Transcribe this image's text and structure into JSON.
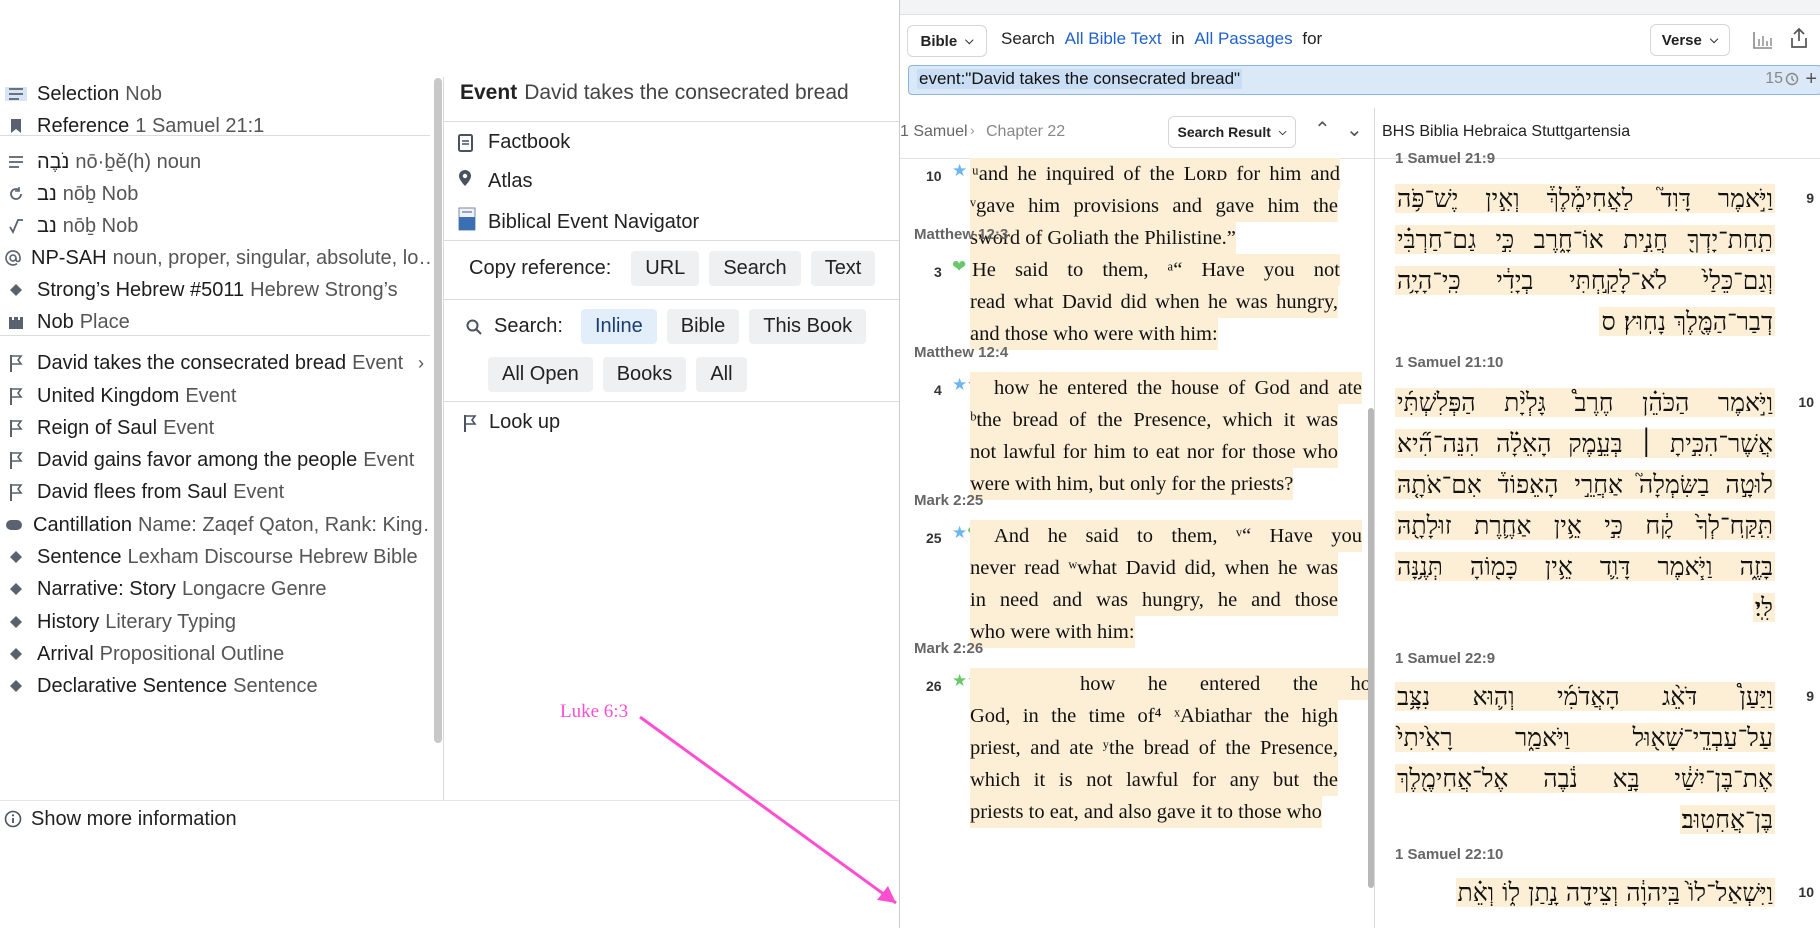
{
  "left_panel": {
    "rows": [
      {
        "icon": "lines-icon",
        "main": "Selection",
        "sub": "Nob"
      },
      {
        "icon": "bookmark-icon",
        "main": "Reference",
        "sub": "1 Samuel 21:1"
      },
      {
        "icon": "lines-icon",
        "main": "נֹבֶה",
        "sub": "nō·ḇě(h) noun"
      },
      {
        "icon": "refresh-icon",
        "main": "נב",
        "sub": "nōḇ Nob"
      },
      {
        "icon": "root-icon",
        "main": "נב",
        "sub": "nōḇ Nob"
      },
      {
        "icon": "at-icon",
        "main": "NP-SAH",
        "sub": "noun, proper, singular, absolute, lo…"
      },
      {
        "icon": "diamond-icon",
        "main": "Strong’s Hebrew #5011",
        "sub": "Hebrew Strong’s"
      },
      {
        "icon": "castle-icon",
        "main": "Nob",
        "sub": "Place"
      },
      {
        "icon": "flag-icon",
        "main": "David takes the consecrated bread",
        "sub": "Event"
      },
      {
        "icon": "flag-icon",
        "main": "United Kingdom",
        "sub": "Event"
      },
      {
        "icon": "flag-icon",
        "main": "Reign of Saul",
        "sub": "Event"
      },
      {
        "icon": "flag-icon",
        "main": "David gains favor among the people",
        "sub": "Event"
      },
      {
        "icon": "flag-icon",
        "main": "David flees from Saul",
        "sub": "Event"
      },
      {
        "icon": "tag-icon",
        "main": "Cantillation",
        "sub": "Name: Zaqef Qaton, Rank: King…"
      },
      {
        "icon": "diamond-icon",
        "main": "Sentence",
        "sub": "Lexham Discourse Hebrew Bible"
      },
      {
        "icon": "diamond-icon",
        "main": "Narrative: Story",
        "sub": "Longacre Genre"
      },
      {
        "icon": "diamond-icon",
        "main": "History",
        "sub": "Literary Typing"
      },
      {
        "icon": "diamond-icon",
        "main": "Arrival",
        "sub": "Propositional Outline"
      },
      {
        "icon": "diamond-icon",
        "main": "Declarative Sentence",
        "sub": "Sentence"
      }
    ],
    "show_more": "Show more information"
  },
  "mid_panel": {
    "title_main": "Event",
    "title_sub": "David takes the consecrated bread",
    "links": [
      "Factbook",
      "Atlas",
      "Biblical Event Navigator"
    ],
    "copy_label": "Copy reference:",
    "copy_buttons": [
      "URL",
      "Search",
      "Text"
    ],
    "search_label": "Search:",
    "search_buttons_row1": [
      "Inline",
      "Bible",
      "This Book"
    ],
    "search_buttons_row2": [
      "All Open",
      "Books",
      "All"
    ],
    "lookup": "Look up"
  },
  "toolbar": {
    "bible_btn": "Bible",
    "search_word": "Search",
    "scope": "All Bible Text",
    "in_word": "in",
    "passages": "All Passages",
    "for_word": "for",
    "verse_btn": "Verse"
  },
  "query": {
    "text": "event:\"David takes the consecrated bread\"",
    "count": "15"
  },
  "left_pane": {
    "breadcrumb_book": "1 Samuel",
    "breadcrumb_chapter": "Chapter 22",
    "search_result_btn": "Search Result",
    "results": [
      {
        "ref": "",
        "num": "10",
        "lines": [
          "ᵘand he inquired of the Lᴏʀᴅ for him and",
          "ᵛgave him provisions and gave him the",
          "sword of Goliath the Philistine.”"
        ]
      },
      {
        "ref": "Matthew 12:3",
        "num": "3",
        "lines": [
          "He said to them, ᵃ“  Have you not",
          "read what David did when he was hungry,",
          "and those who were with him:"
        ]
      },
      {
        "ref": "Matthew 12:4",
        "num": "4",
        "lines": [
          "how he entered the house of God and ate",
          "ᵇthe bread of the Presence, which it was",
          "not lawful for him to eat nor for those who",
          "were with him, but only for the priests?"
        ]
      },
      {
        "ref": "Mark 2:25",
        "num": "25",
        "lines": [
          "And he said to them, ᵛ“  Have you",
          "never read ʷwhat David did, when he was",
          "in need and was hungry, he and those",
          "who were with him:"
        ]
      },
      {
        "ref": "Mark 2:26",
        "num": "26",
        "lines": [
          "how he entered the house of",
          "God, in the time of⁴ ˣAbiathar the high",
          "priest, and ate ʸthe bread of the Presence,",
          "which it is not lawful for any but the",
          "priests to eat, and also gave it to those who"
        ]
      }
    ]
  },
  "right_pane": {
    "title": "BHS Biblia Hebraica Stuttgartensia",
    "blocks": [
      {
        "ref": "1 Samuel 21:9",
        "num": "9",
        "lines": [
          "וַיֹּ֣אמֶר דָּוִד֮ לַאֲחִימֶ֒לֶךְ֒ וְאִ֣ין יֶשׁ־פֹּ֥ה",
          "תַֽחַת־יָדְךָ֖ חֲנִ֣ית אוֹ־חָ֑רֶב כִּ֣י גַם־חַרְבִּ֗י",
          "וְגַם־כֵּלַי֙ לֹא־לָקַ֣חְתִּי בְיָדִ֔י כִּֽי־הָיָ֥ה",
          "דְבַר־הַמֶּ֖לֶךְ נָחֽוּץ׃ ס"
        ]
      },
      {
        "ref": "1 Samuel 21:10",
        "num": "10",
        "lines": [
          "וַיֹּ֣אמֶר הַכֹּהֵ֗ן חֶרֶב֩ גָּלְיָ֨ת הַפְּלִשְׁתִּ֜י",
          "אֲשֶׁר־הִכִּ֣יתָ ׀ בְּעֵ֣מֶק הָאֵלָ֗ה הִנֵּה־הִ֞יא",
          "לוּטָ֣ה בַשִּׂמְלָה֮ אַחֲרֵ֣י הָאֵפוֹד֒ אִם־אֹתָ֤הּ",
          "תִּֽקַּֽח־לְךָ֙ קָ֔ח כִּ֣י אֵ֥ין אַחֶ֛רֶת זוּלָתָ֖הּ",
          "בָּזֶ֑ה וַיֹּ֧אמֶר דָּוִ֛ד אֵ֥ין כָּמ֖וֹהָ תְּנֶ֥נָּה",
          "לִּֽי׃"
        ]
      },
      {
        "ref": "1 Samuel 22:9",
        "num": "9",
        "lines": [
          "וַיַּעַן֩ דֹּאֵ֨ג הָאֲדֹמִ֜י וְה֛וּא נִצָּ֥ב",
          "עַל־עַבְדֵֽי־שָׁא֖וּל וַיֹּאמַ֑ר רָאִ֙יתִי֙",
          "אֶת־בֶּן־יִשַׁ֔י בָּ֣א נֹ֔בֶה אֶל־אֲחִימֶ֖לֶךְ",
          "בֶּן־אֲחִטֽוּב׃"
        ]
      },
      {
        "ref": "1 Samuel 22:10",
        "num": "10",
        "lines": [
          "וַיִּשְׁאַל־לוֹ֙ בַּֽיהוָ֔ה וְצֵידָ֖ה נָ֣תַן ל֑וֹ וְאֵ֗ת"
        ]
      }
    ]
  },
  "annotation": {
    "label": "Luke 6:3",
    "color": "#ff4fd1"
  }
}
